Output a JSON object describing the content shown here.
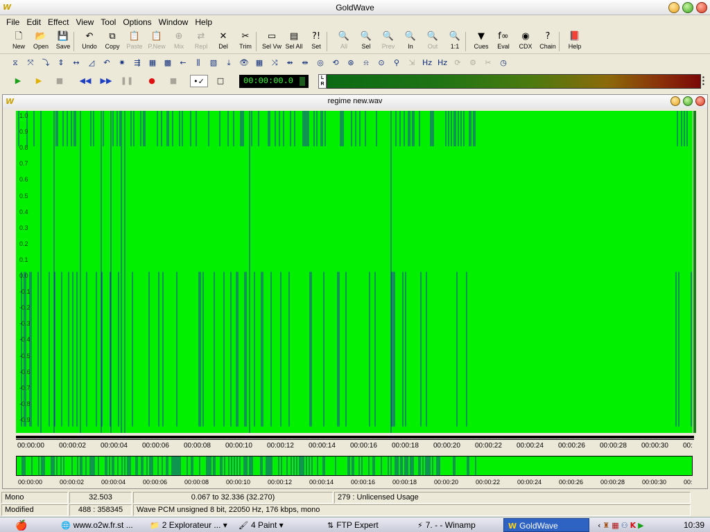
{
  "app": {
    "title": "GoldWave",
    "logo_text": "W"
  },
  "menu": [
    "File",
    "Edit",
    "Effect",
    "View",
    "Tool",
    "Options",
    "Window",
    "Help"
  ],
  "toolbar1": [
    {
      "label": "New",
      "icon": "new-icon",
      "glyph": "🗋",
      "enabled": true
    },
    {
      "label": "Open",
      "icon": "open-icon",
      "glyph": "📂",
      "enabled": true
    },
    {
      "label": "Save",
      "icon": "save-icon",
      "glyph": "💾",
      "enabled": true
    },
    {
      "label": "Undo",
      "icon": "undo-icon",
      "glyph": "↶",
      "enabled": true
    },
    {
      "label": "Copy",
      "icon": "copy-icon",
      "glyph": "⧉",
      "enabled": true
    },
    {
      "label": "Paste",
      "icon": "paste-icon",
      "glyph": "📋",
      "enabled": false
    },
    {
      "label": "P.New",
      "icon": "paste-new-icon",
      "glyph": "📋",
      "enabled": false
    },
    {
      "label": "Mix",
      "icon": "mix-icon",
      "glyph": "⊕",
      "enabled": false
    },
    {
      "label": "Repl",
      "icon": "replace-icon",
      "glyph": "⇄",
      "enabled": false
    },
    {
      "label": "Del",
      "icon": "delete-icon",
      "glyph": "✕",
      "enabled": true
    },
    {
      "label": "Trim",
      "icon": "trim-icon",
      "glyph": "✂",
      "enabled": true
    },
    {
      "label": "Sel Vw",
      "icon": "select-view-icon",
      "glyph": "▭",
      "enabled": true
    },
    {
      "label": "Sel All",
      "icon": "select-all-icon",
      "glyph": "▤",
      "enabled": true
    },
    {
      "label": "Set",
      "icon": "set-icon",
      "glyph": "?!",
      "enabled": true
    },
    {
      "label": "All",
      "icon": "zoom-all-icon",
      "glyph": "🔍",
      "enabled": false
    },
    {
      "label": "Sel",
      "icon": "zoom-selection-icon",
      "glyph": "🔍",
      "enabled": true
    },
    {
      "label": "Prev",
      "icon": "zoom-previous-icon",
      "glyph": "🔍",
      "enabled": false
    },
    {
      "label": "In",
      "icon": "zoom-in-icon",
      "glyph": "🔍",
      "enabled": true
    },
    {
      "label": "Out",
      "icon": "zoom-out-icon",
      "glyph": "🔍",
      "enabled": false
    },
    {
      "label": "1:1",
      "icon": "zoom-1to1-icon",
      "glyph": "🔍",
      "enabled": true
    },
    {
      "label": "Cues",
      "icon": "cues-icon",
      "glyph": "▼",
      "enabled": true
    },
    {
      "label": "Eval",
      "icon": "eval-icon",
      "glyph": "f∞",
      "enabled": true
    },
    {
      "label": "CDX",
      "icon": "cd-extract-icon",
      "glyph": "◉",
      "enabled": true
    },
    {
      "label": "Chain",
      "icon": "chain-icon",
      "glyph": "?",
      "enabled": true
    },
    {
      "label": "Help",
      "icon": "help-book-icon",
      "glyph": "📕",
      "enabled": true
    }
  ],
  "toolbar2": [
    {
      "icon": "auto-gain-icon",
      "glyph": "⧖",
      "enabled": true
    },
    {
      "icon": "band-reject-icon",
      "glyph": "⤧",
      "enabled": true
    },
    {
      "icon": "compressor-icon",
      "glyph": "⤵",
      "enabled": true
    },
    {
      "icon": "dynamics-icon",
      "glyph": "⇕",
      "enabled": true
    },
    {
      "icon": "echo-icon",
      "glyph": "↔",
      "enabled": true
    },
    {
      "icon": "fade-icon",
      "glyph": "◿",
      "enabled": true
    },
    {
      "icon": "invert-icon",
      "glyph": "↶",
      "enabled": true
    },
    {
      "icon": "mechanize-icon",
      "glyph": "✷",
      "enabled": true
    },
    {
      "icon": "equalizer-icon",
      "glyph": "⇶",
      "enabled": true
    },
    {
      "icon": "spectrum-filter-icon",
      "glyph": "▦",
      "enabled": true
    },
    {
      "icon": "parametric-eq-icon",
      "glyph": "▩",
      "enabled": true
    },
    {
      "icon": "reverse-icon",
      "glyph": "←",
      "enabled": true
    },
    {
      "icon": "resample-icon",
      "glyph": "⫼",
      "enabled": true
    },
    {
      "icon": "noise-reduction-icon",
      "glyph": "▧",
      "enabled": true
    },
    {
      "icon": "pop-click-icon",
      "glyph": "⤓",
      "enabled": true
    },
    {
      "icon": "doppler-icon",
      "glyph": "👁",
      "enabled": true
    },
    {
      "icon": "pan-icon",
      "glyph": "▦",
      "enabled": true
    },
    {
      "icon": "pitch-icon",
      "glyph": "⤨",
      "enabled": true
    },
    {
      "icon": "reverb-icon",
      "glyph": "⇴",
      "enabled": true
    },
    {
      "icon": "silence-reduction-icon",
      "glyph": "⇹",
      "enabled": true
    },
    {
      "icon": "playback-rate-icon",
      "glyph": "◎",
      "enabled": true
    },
    {
      "icon": "time-warp-icon",
      "glyph": "⟲",
      "enabled": true
    },
    {
      "icon": "volume-icon",
      "glyph": "⊛",
      "enabled": true
    },
    {
      "icon": "volume-shape-icon",
      "glyph": "⍾",
      "enabled": true
    },
    {
      "icon": "offset-icon",
      "glyph": "⊙",
      "enabled": true
    },
    {
      "icon": "zoom-effect-icon",
      "glyph": "⚲",
      "enabled": true
    },
    {
      "icon": "lowpass-icon",
      "glyph": "⇲",
      "enabled": false
    },
    {
      "icon": "hz-left-icon",
      "glyph": "Hz",
      "enabled": true
    },
    {
      "icon": "hz-right-icon",
      "glyph": "Hz",
      "enabled": true
    },
    {
      "icon": "effect-disabled-1-icon",
      "glyph": "⟳",
      "enabled": false
    },
    {
      "icon": "effect-disabled-2-icon",
      "glyph": "⚙",
      "enabled": false
    },
    {
      "icon": "effect-disabled-3-icon",
      "glyph": "✂",
      "enabled": false
    },
    {
      "icon": "clock-icon",
      "glyph": "◷",
      "enabled": true
    }
  ],
  "transport": {
    "play_icon": "play-icon",
    "play_glyph": "▶",
    "play_color": "#1a9f1a",
    "play_sel_icon": "play-selection-icon",
    "play_sel_glyph": "▶",
    "play_sel_color": "#e0b000",
    "stop_icon": "stop-icon",
    "stop_glyph": "■",
    "rewind_icon": "rewind-icon",
    "rewind_glyph": "◀◀",
    "ffwd_icon": "fast-forward-icon",
    "ffwd_glyph": "▶▶",
    "pause_icon": "pause-icon",
    "pause_glyph": "❚❚",
    "record_icon": "record-icon",
    "record_glyph": "●",
    "record_color": "#e01010",
    "stop_rec_icon": "stop-record-icon",
    "stop_rec_glyph": "■",
    "options_icon": "transport-options-icon",
    "options_glyph": "•✓",
    "square_icon": "window-square-icon",
    "square_glyph": "□",
    "time": "00:00:00.0",
    "level_lr": "L\nR"
  },
  "document": {
    "title": "regime new.wav",
    "y_labels": [
      "1.0",
      "0.9",
      "0.8",
      "0.7",
      "0.6",
      "0.5",
      "0.4",
      "0.3",
      "0.2",
      "0.1",
      "0.0",
      "-0.1",
      "-0.2",
      "-0.3",
      "-0.4",
      "-0.5",
      "-0.6",
      "-0.7",
      "-0.8",
      "-0.9"
    ],
    "y_labels_values": [
      1.0,
      0.9,
      0.8,
      0.7,
      0.6,
      0.5,
      0.4,
      0.3,
      0.2,
      0.1,
      0.0,
      -0.1,
      -0.2,
      -0.3,
      -0.4,
      -0.5,
      -0.6,
      -0.7,
      -0.8,
      -0.9
    ],
    "time_labels": [
      "00:00:00",
      "00:00:02",
      "00:00:04",
      "00:00:06",
      "00:00:08",
      "00:00:10",
      "00:00:12",
      "00:00:14",
      "00:00:16",
      "00:00:18",
      "00:00:20",
      "00:00:22",
      "00:00:24",
      "00:00:26",
      "00:00:28",
      "00:00:30",
      "00:"
    ],
    "duration_seconds": 32.503,
    "wave_color": "#00f000",
    "wave_line_color": "#1e3aa0",
    "background_color": "#000000"
  },
  "status": {
    "channels": "Mono",
    "length": "32.503",
    "selection": "0.067 to 32.336 (32.270)",
    "license": "279 : Unlicensed Usage",
    "state": "Modified",
    "samples": "488 : 358345",
    "format": "Wave PCM unsigned 8 bit, 22050 Hz, 176 kbps, mono"
  },
  "taskbar": {
    "start_icon": "apple-start-icon",
    "items": [
      {
        "label": "www.o2w.fr.st ...",
        "icon": "browser-icon",
        "glyph": "🌐",
        "active": false
      },
      {
        "label": "2 Explorateur ...",
        "icon": "folder-icon",
        "glyph": "📁",
        "active": false
      },
      {
        "label": "4 Paint",
        "icon": "paint-icon",
        "glyph": "🖌",
        "active": false
      },
      {
        "label": "FTP Expert",
        "icon": "ftp-icon",
        "glyph": "⇅",
        "active": false
      },
      {
        "label": "7. - - Winamp",
        "icon": "winamp-icon",
        "glyph": "⚡",
        "active": false
      },
      {
        "label": "GoldWave",
        "icon": "goldwave-icon",
        "glyph": "W",
        "active": true
      }
    ],
    "tray_icons": [
      "tray-arrow-icon",
      "tray-app1-icon",
      "tray-app2-icon",
      "tray-network-icon",
      "tray-k-icon",
      "tray-play-icon"
    ],
    "clock": "10:39"
  }
}
